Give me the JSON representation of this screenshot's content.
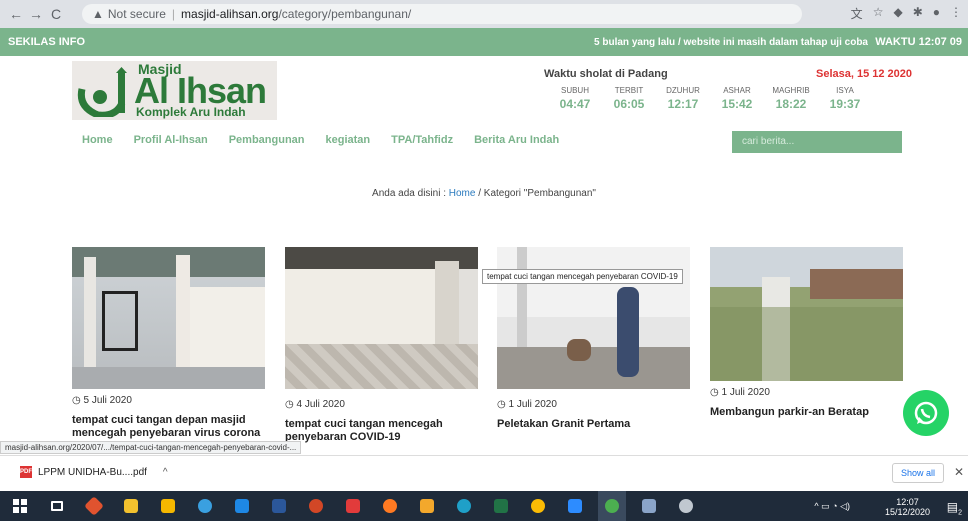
{
  "browser": {
    "back": "←",
    "forward": "→",
    "reload": "C",
    "secure_label": "Not secure",
    "url_host": "masjid-alihsan.org",
    "url_path": "/category/pembangunan/"
  },
  "infobar": {
    "label": "SEKILAS INFO",
    "ticker": "5 bulan yang lalu / website ini masih dalam tahap uji coba",
    "time": "WAKTU 12:07 09"
  },
  "logo": {
    "line1": "Masjid",
    "line2": "Al Ihsan",
    "line3": "Komplek Aru Indah"
  },
  "prayer": {
    "title": "Waktu sholat di Padang",
    "date": "Selasa, 15 12 2020",
    "times": [
      {
        "name": "SUBUH",
        "time": "04:47"
      },
      {
        "name": "TERBIT",
        "time": "06:05"
      },
      {
        "name": "DZUHUR",
        "time": "12:17"
      },
      {
        "name": "ASHAR",
        "time": "15:42"
      },
      {
        "name": "MAGHRIB",
        "time": "18:22"
      },
      {
        "name": "ISYA",
        "time": "19:37"
      }
    ]
  },
  "menu": [
    "Home",
    "Profil Al-Ihsan",
    "Pembangunan",
    "kegiatan",
    "TPA/Tahfidz",
    "Berita Aru Indah"
  ],
  "search": {
    "placeholder": "cari berita..."
  },
  "breadcrumb": {
    "prefix": "Anda ada disini : ",
    "home": "Home",
    "suffix": " / Kategori \"Pembangunan\""
  },
  "posts": [
    {
      "date": "5 Juli 2020",
      "title": "tempat cuci tangan depan masjid mencegah penyebaran virus corona"
    },
    {
      "date": "4 Juli 2020",
      "title": "tempat cuci tangan mencegah penyebaran COVID-19"
    },
    {
      "date": "1 Juli 2020",
      "title": "Peletakan Granit Pertama"
    },
    {
      "date": "1 Juli 2020",
      "title": "Membangun parkir-an Beratap"
    }
  ],
  "tooltip": "tempat cuci tangan mencegah penyebaran COVID-19",
  "status_url": "masjid-alihsan.org/2020/07/.../tempat-cuci-tangan-mencegah-penyebaran-covid-...",
  "download": {
    "file": "LPPM UNIDHA-Bu....pdf",
    "show_all": "Show all"
  },
  "taskbar": {
    "time": "12:07",
    "date": "15/12/2020",
    "notif_count": "2"
  }
}
